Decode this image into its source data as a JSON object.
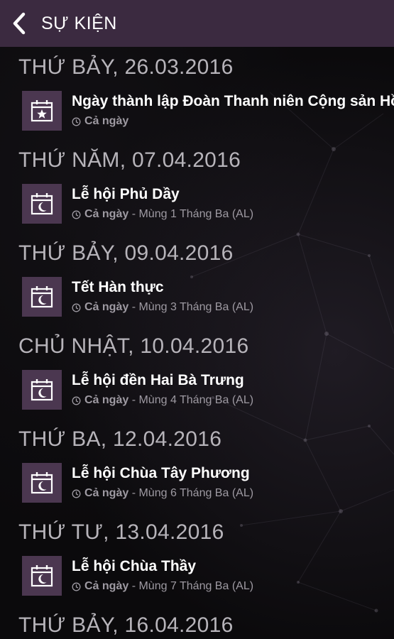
{
  "header": {
    "title": "SỰ KIỆN"
  },
  "days": [
    {
      "date": "THỨ BẢY, 26.03.2016",
      "events": [
        {
          "title": "Ngày thành lập Đoàn Thanh niên Cộng sản Hồ Chí Minh",
          "all_day": "Cả ngày",
          "lunar": "",
          "icon": "calendar-star-icon"
        }
      ]
    },
    {
      "date": "THỨ NĂM, 07.04.2016",
      "events": [
        {
          "title": "Lễ hội Phủ Dầy",
          "all_day": "Cả ngày",
          "lunar": " - Mùng 1 Tháng Ba (AL)",
          "icon": "calendar-moon-icon"
        }
      ]
    },
    {
      "date": "THỨ BẢY, 09.04.2016",
      "events": [
        {
          "title": "Tết Hàn thực",
          "all_day": "Cả ngày",
          "lunar": " - Mùng 3 Tháng Ba (AL)",
          "icon": "calendar-moon-icon"
        }
      ]
    },
    {
      "date": "CHỦ NHẬT, 10.04.2016",
      "events": [
        {
          "title": "Lễ hội đền Hai Bà Trưng",
          "all_day": "Cả ngày",
          "lunar": " - Mùng 4 Tháng Ba (AL)",
          "icon": "calendar-moon-icon"
        }
      ]
    },
    {
      "date": "THỨ BA, 12.04.2016",
      "events": [
        {
          "title": "Lễ hội Chùa Tây Phương",
          "all_day": "Cả ngày",
          "lunar": " - Mùng 6 Tháng Ba (AL)",
          "icon": "calendar-moon-icon"
        }
      ]
    },
    {
      "date": "THỨ TƯ, 13.04.2016",
      "events": [
        {
          "title": "Lễ hội Chùa Thầy",
          "all_day": "Cả ngày",
          "lunar": " - Mùng 7 Tháng Ba (AL)",
          "icon": "calendar-moon-icon"
        }
      ]
    },
    {
      "date": "THỨ BẢY, 16.04.2016",
      "events": []
    }
  ]
}
